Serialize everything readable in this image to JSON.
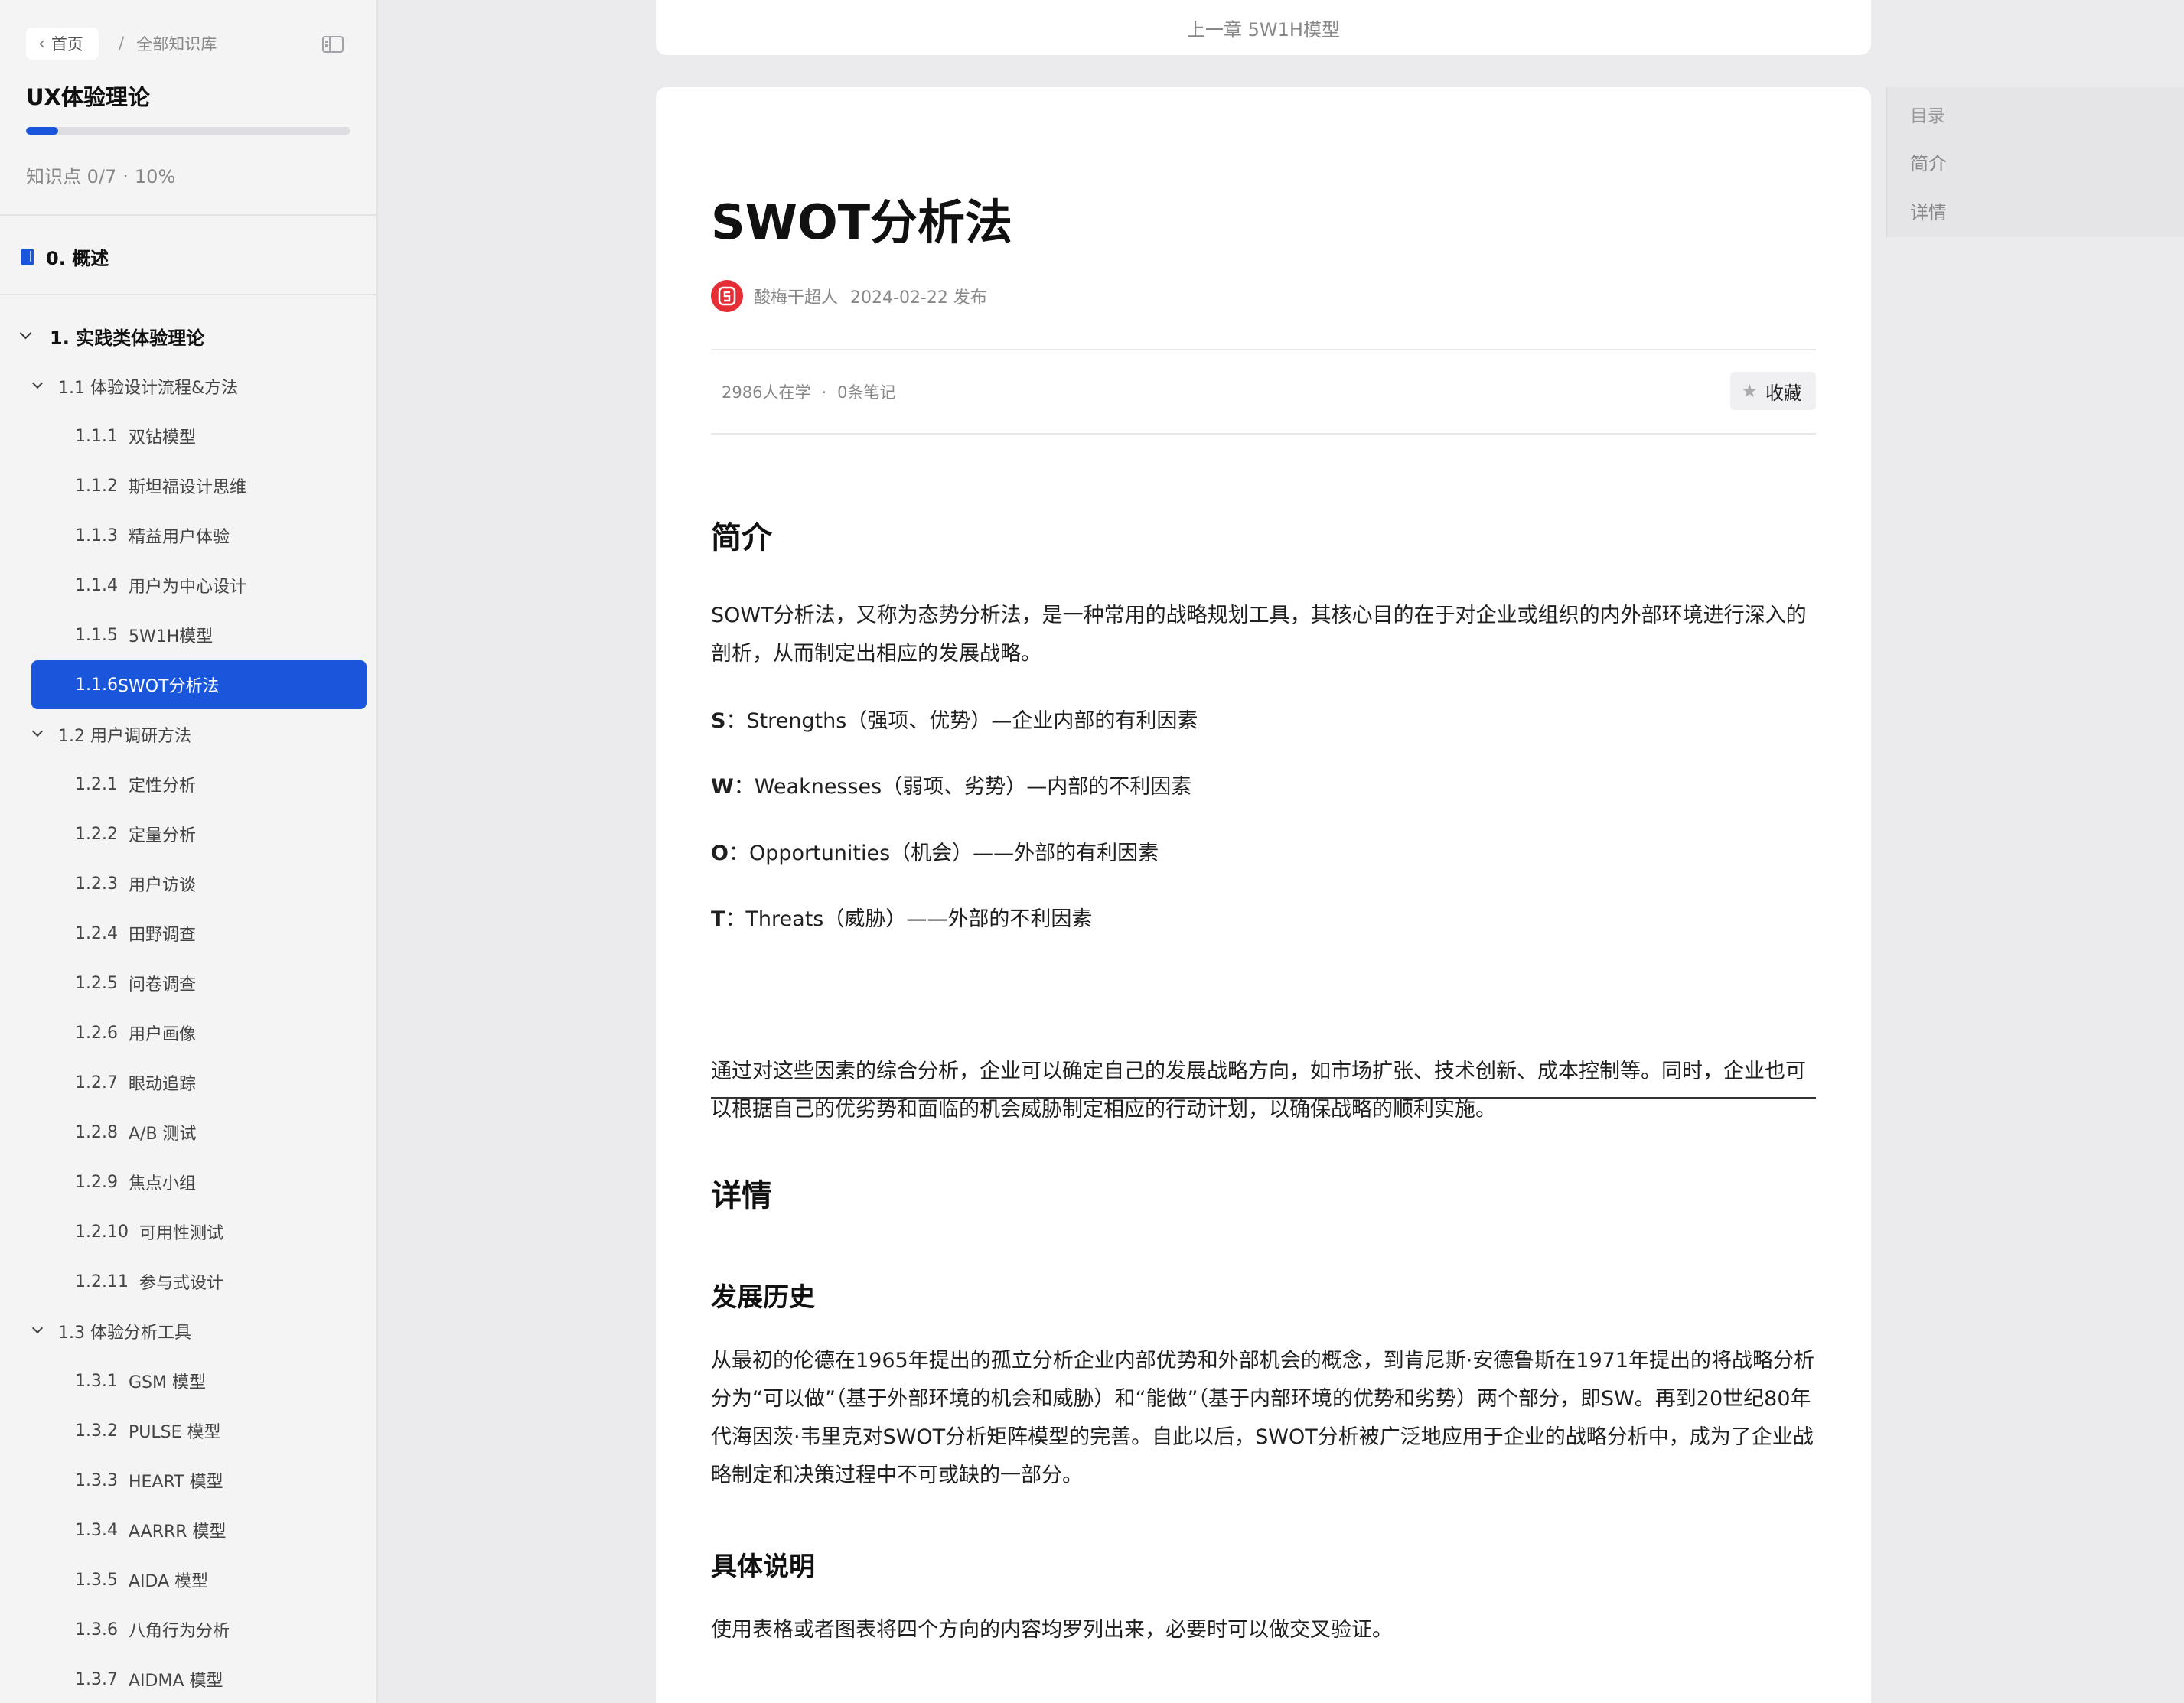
{
  "sidebar": {
    "home_label": "首页",
    "crumb_separator": "/",
    "library_label": "全部知识库",
    "book_title": "UX体验理论",
    "progress_fraction": 0.1,
    "progress_label": "知识点 0/7",
    "progress_percent_text": "10%",
    "progress_dot": "·",
    "section0_title": "0. 概述",
    "section1_title": "1. 实践类体验理论",
    "toc": [
      {
        "kind": "sub",
        "text": "1.1  体验设计流程&方法"
      },
      {
        "kind": "leaf",
        "num": "1.1.1",
        "text": "双钻模型"
      },
      {
        "kind": "leaf",
        "num": "1.1.2",
        "text": "斯坦福设计思维"
      },
      {
        "kind": "leaf",
        "num": "1.1.3",
        "text": "精益用户体验"
      },
      {
        "kind": "leaf",
        "num": "1.1.4",
        "text": "用户为中心设计"
      },
      {
        "kind": "leaf",
        "num": "1.1.5",
        "text": "5W1H模型"
      },
      {
        "kind": "active",
        "num": "1.1.6",
        "text": "SWOT分析法"
      },
      {
        "kind": "sub",
        "text": "1.2  用户调研方法"
      },
      {
        "kind": "leaf",
        "num": "1.2.1",
        "text": "定性分析"
      },
      {
        "kind": "leaf",
        "num": "1.2.2",
        "text": "定量分析"
      },
      {
        "kind": "leaf",
        "num": "1.2.3",
        "text": "用户访谈"
      },
      {
        "kind": "leaf",
        "num": "1.2.4",
        "text": "田野调查"
      },
      {
        "kind": "leaf",
        "num": "1.2.5",
        "text": "问卷调查"
      },
      {
        "kind": "leaf",
        "num": "1.2.6",
        "text": "用户画像"
      },
      {
        "kind": "leaf",
        "num": "1.2.7",
        "text": "眼动追踪"
      },
      {
        "kind": "leaf",
        "num": "1.2.8",
        "text": "A/B 测试"
      },
      {
        "kind": "leaf",
        "num": "1.2.9",
        "text": "焦点小组"
      },
      {
        "kind": "leaf",
        "num": "1.2.10",
        "text": "可用性测试"
      },
      {
        "kind": "leaf",
        "num": "1.2.11",
        "text": "参与式设计"
      },
      {
        "kind": "sub",
        "text": "1.3  体验分析工具"
      },
      {
        "kind": "leaf",
        "num": "1.3.1",
        "text": "GSM 模型"
      },
      {
        "kind": "leaf",
        "num": "1.3.2",
        "text": "PULSE 模型"
      },
      {
        "kind": "leaf",
        "num": "1.3.3",
        "text": "HEART 模型"
      },
      {
        "kind": "leaf",
        "num": "1.3.4",
        "text": "AARRR 模型"
      },
      {
        "kind": "leaf",
        "num": "1.3.5",
        "text": "AIDA 模型"
      },
      {
        "kind": "leaf",
        "num": "1.3.6",
        "text": "八角行为分析"
      },
      {
        "kind": "leaf",
        "num": "1.3.7",
        "text": "AIDMA 模型"
      }
    ]
  },
  "prev_chapter": "上一章 5W1H模型",
  "article": {
    "title": "SWOT分析法",
    "author": "酸梅干超人",
    "publish_date": "2024-02-22 发布",
    "readers": "2986人在学",
    "stats_dot": "·",
    "notes": "0条笔记",
    "favorite_label": "收藏",
    "intro_heading": "简介",
    "intro_para": "SOWT分析法，又称为态势分析法，是一种常用的战略规划工具，其核心目的在于对企业或组织的内外部环境进行深入的剖析，从而制定出相应的发展战略。",
    "swot": [
      {
        "letter": "S",
        "text": "：Strengths（强项、优势）—企业内部的有利因素"
      },
      {
        "letter": "W",
        "text": "：Weaknesses（弱项、劣势）—内部的不利因素"
      },
      {
        "letter": "O",
        "text": "：Opportunities（机会）——外部的有利因素"
      },
      {
        "letter": "T",
        "text": "：Threats（威胁）——外部的不利因素"
      }
    ],
    "summary_para": "通过对这些因素的综合分析，企业可以确定自己的发展战略方向，如市场扩张、技术创新、成本控制等。同时，企业也可以根据自己的优劣势和面临的机会威胁制定相应的行动计划，以确保战略的顺利实施。",
    "detail_heading": "详情",
    "history_heading": "发展历史",
    "history_para": "从最初的伦德在1965年提出的孤立分析企业内部优势和外部机会的概念，到肯尼斯·安德鲁斯在1971年提出的将战略分析分为“可以做”（基于外部环境的机会和威胁）和“能做”（基于内部环境的优势和劣势）两个部分，即SW。再到20世纪80年代海因茨·韦里克对SWOT分析矩阵模型的完善。自此以后，SWOT分析被广泛地应用于企业的战略分析中，成为了企业战略制定和决策过程中不可或缺的一部分。",
    "explain_heading": "具体说明",
    "explain_para": "使用表格或者图表将四个方向的内容均罗列出来，必要时可以做交叉验证。"
  },
  "right_toc": {
    "heading": "目录",
    "items": [
      "简介",
      "详情"
    ]
  }
}
